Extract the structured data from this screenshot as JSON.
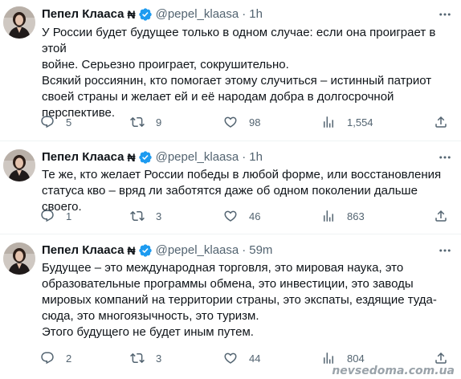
{
  "tweets": [
    {
      "name": "Пепел Клааса",
      "flag": "₦",
      "handle": "@pepel_klaasa",
      "sep": "·",
      "time": "1h",
      "lines": [
        "У России будет будущее только в одном случае: если она проиграет в этой",
        "войне. Серьезно проиграет, сокрушительно.",
        "Всякий россиянин, кто помогает этому случиться – истинный патриот",
        "своей страны и желает ей и её народам добра в долгосрочной",
        "перспективе."
      ],
      "replies": "5",
      "retweets": "9",
      "likes": "98",
      "views": "1,554"
    },
    {
      "name": "Пепел Клааса",
      "flag": "₦",
      "handle": "@pepel_klaasa",
      "sep": "·",
      "time": "1h",
      "lines": [
        "Те же, кто желает России победы в любой форме, или восстановления",
        "статуса кво – вряд ли заботятся даже об одном поколении дальше своего."
      ],
      "replies": "1",
      "retweets": "3",
      "likes": "46",
      "views": "863"
    },
    {
      "name": "Пепел Клааса",
      "flag": "₦",
      "handle": "@pepel_klaasa",
      "sep": "·",
      "time": "59m",
      "lines": [
        "Будущее – это международная торговля, это мировая наука, это",
        "образовательные программы обмена, это инвестиции, это заводы",
        "мировых компаний на территории страны, это экспаты, ездящие туда-",
        "сюда, это многоязычность, это туризм.",
        "Этого будущего не будет иным путем."
      ],
      "replies": "2",
      "retweets": "3",
      "likes": "44",
      "views": "804"
    }
  ],
  "icons": {
    "verified": "verified-badge-icon",
    "more": "more-options-icon",
    "reply": "reply-icon",
    "retweet": "retweet-icon",
    "like": "like-icon",
    "views": "views-icon",
    "share": "share-icon"
  },
  "colors": {
    "verified": "#1d9bf0",
    "muted": "#536471",
    "text": "#0f1419"
  },
  "watermark": "nevsedoma.com.ua"
}
